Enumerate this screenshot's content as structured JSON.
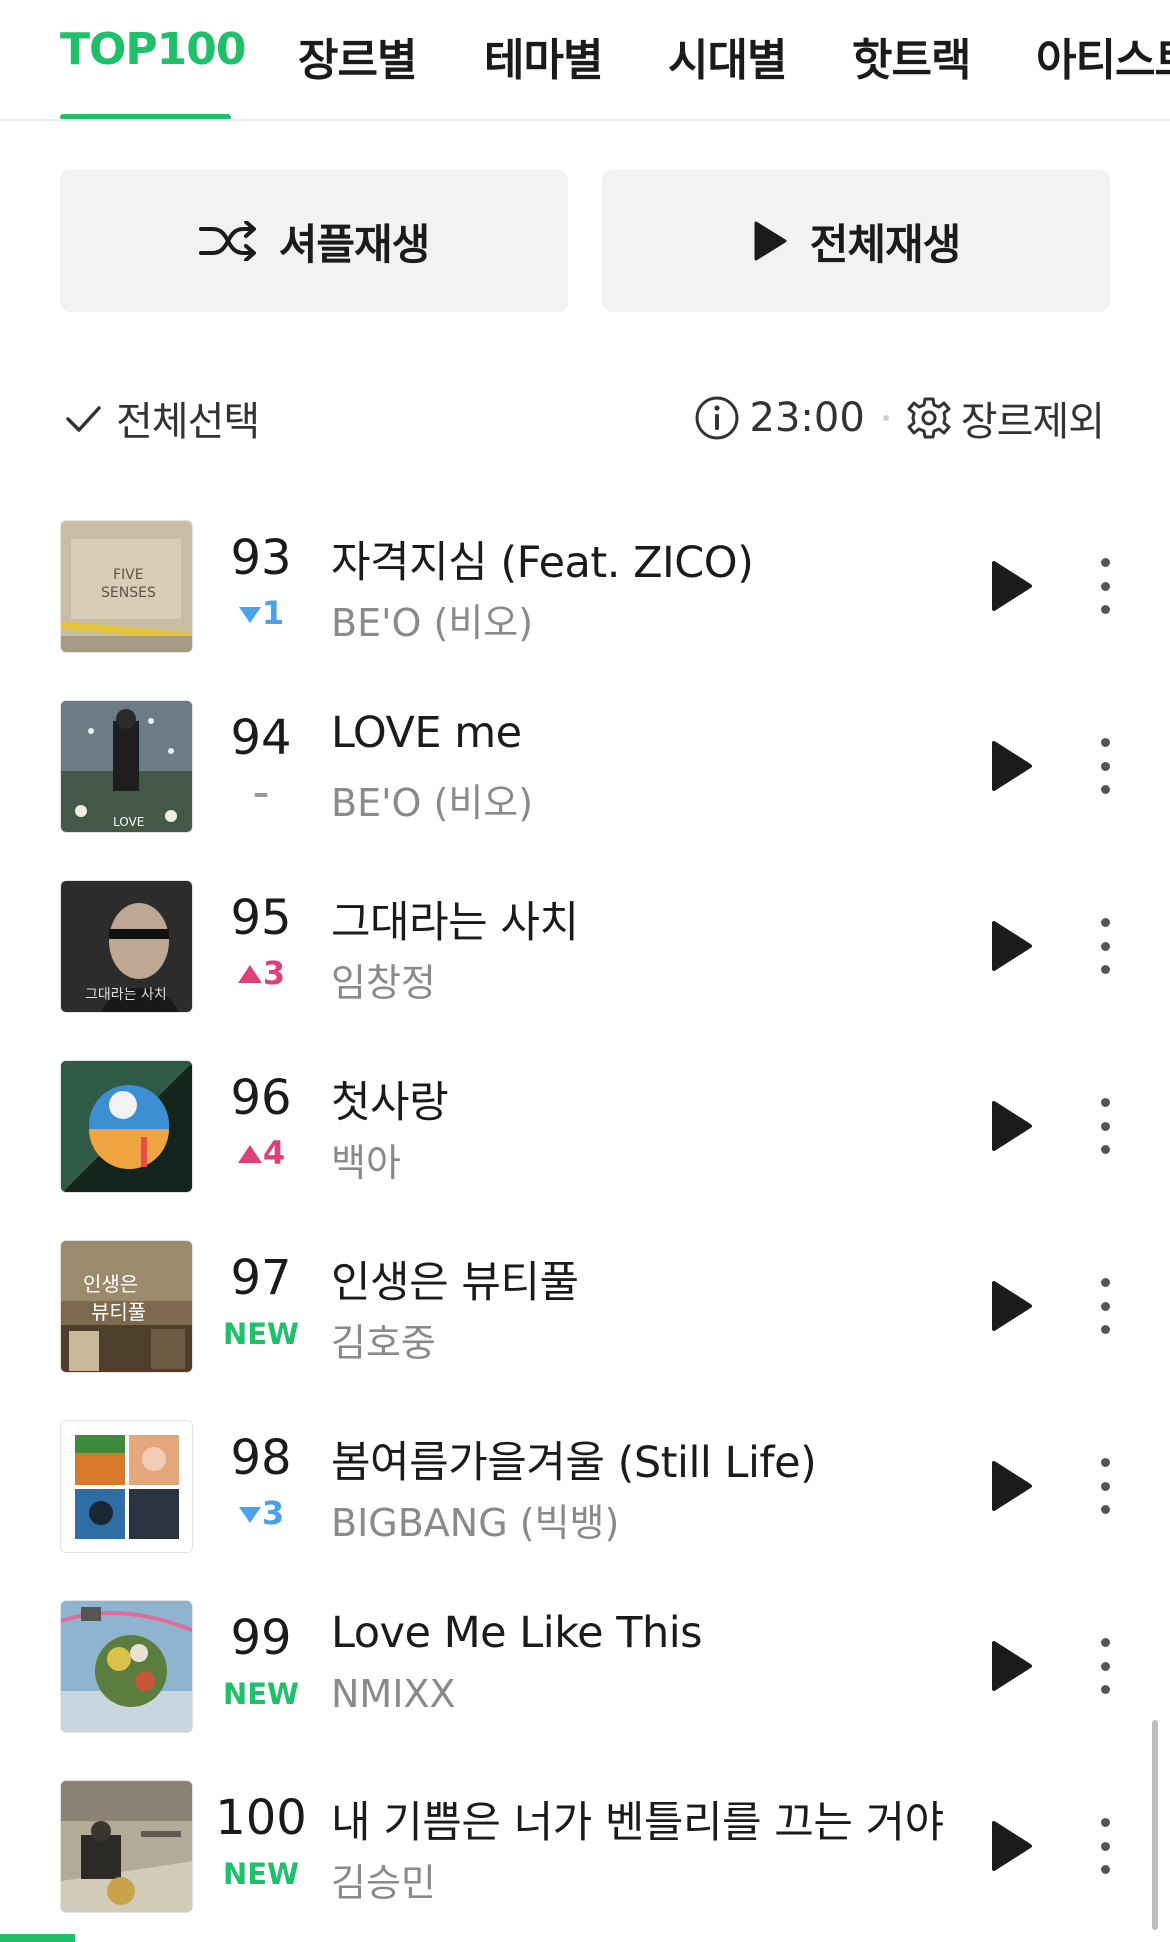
{
  "tabs": [
    {
      "label": "TOP100",
      "active": true
    },
    {
      "label": "장르별",
      "active": false
    },
    {
      "label": "테마별",
      "active": false
    },
    {
      "label": "시대별",
      "active": false
    },
    {
      "label": "핫트랙",
      "active": false
    },
    {
      "label": "아티스트",
      "active": false
    }
  ],
  "actions": {
    "shuffle_icon": "shuffle-icon",
    "shuffle_label": "셔플재생",
    "play_all_icon": "play-icon",
    "play_all_label": "전체재생"
  },
  "toolbar": {
    "select_all_icon": "checkmark-icon",
    "select_all_label": "전체선택",
    "info_icon": "info-icon",
    "time": "23:00",
    "settings_icon": "gear-icon",
    "exclude_genre_label": "장르제외"
  },
  "colors": {
    "accent": "#1fc06a",
    "rank_up": "#e0407a",
    "rank_down": "#4aa3e8"
  },
  "songs": [
    {
      "rank": "93",
      "change_dir": "down",
      "change": "1",
      "title": "자격지심 (Feat. ZICO)",
      "artist": "BE'O (비오)"
    },
    {
      "rank": "94",
      "change_dir": "same",
      "change": "–",
      "title": "LOVE me",
      "artist": "BE'O (비오)"
    },
    {
      "rank": "95",
      "change_dir": "up",
      "change": "3",
      "title": "그대라는 사치",
      "artist": "임창정"
    },
    {
      "rank": "96",
      "change_dir": "up",
      "change": "4",
      "title": "첫사랑",
      "artist": "백아"
    },
    {
      "rank": "97",
      "change_dir": "new",
      "change": "NEW",
      "title": "인생은 뷰티풀",
      "artist": "김호중"
    },
    {
      "rank": "98",
      "change_dir": "down",
      "change": "3",
      "title": "봄여름가을겨울 (Still Life)",
      "artist": "BIGBANG (빅뱅)"
    },
    {
      "rank": "99",
      "change_dir": "new",
      "change": "NEW",
      "title": "Love Me Like This",
      "artist": "NMIXX"
    },
    {
      "rank": "100",
      "change_dir": "new",
      "change": "NEW",
      "title": "내 기쁨은 너가 벤틀리를 끄는 거야",
      "artist": "김승민"
    }
  ]
}
